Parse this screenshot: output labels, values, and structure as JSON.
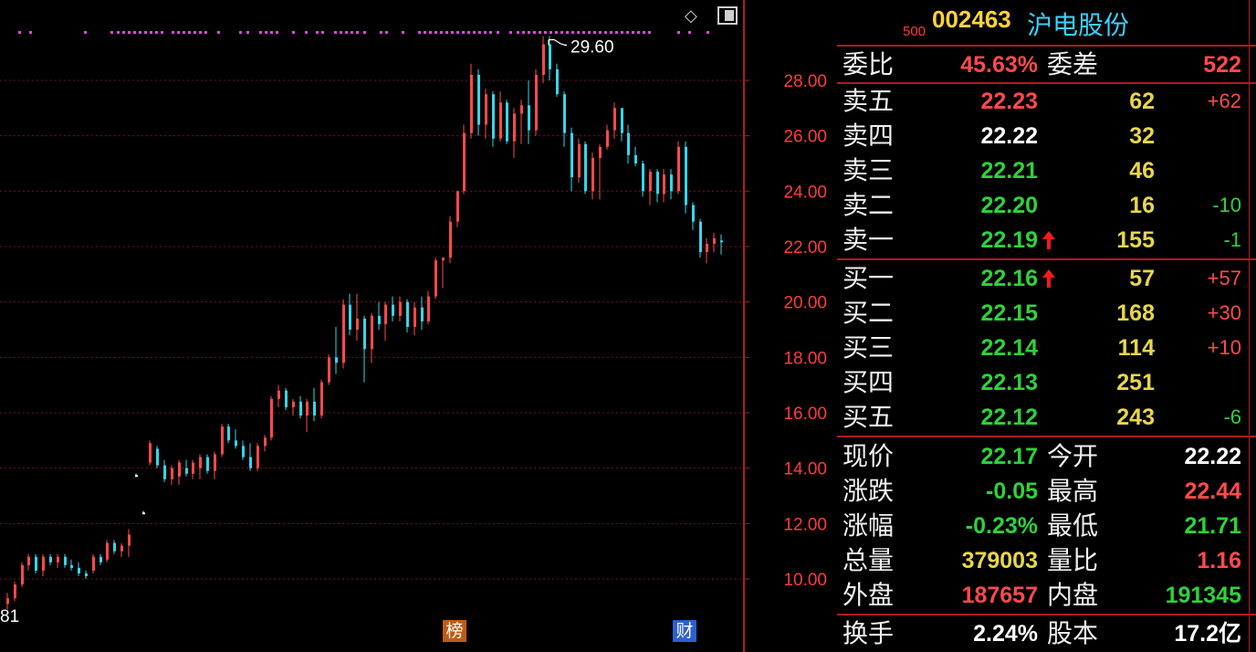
{
  "chart_data": {
    "type": "candlestick",
    "y_ticks": [
      "28.00",
      "26.00",
      "24.00",
      "22.00",
      "20.00",
      "18.00",
      "16.00",
      "14.00",
      "12.00",
      "10.00"
    ],
    "y_tick_values": [
      28,
      26,
      24,
      22,
      20,
      18,
      16,
      14,
      12,
      10
    ],
    "max_label": "29.60",
    "min_label_partial": "81",
    "candles": [
      [
        9.1,
        9.5,
        8.9,
        9.3
      ],
      [
        9.3,
        9.9,
        9.2,
        9.8
      ],
      [
        9.8,
        10.6,
        9.7,
        10.5
      ],
      [
        10.5,
        10.9,
        10.3,
        10.8
      ],
      [
        10.8,
        10.9,
        10.2,
        10.3
      ],
      [
        10.3,
        10.9,
        10.1,
        10.8
      ],
      [
        10.8,
        10.9,
        10.5,
        10.6
      ],
      [
        10.6,
        10.9,
        10.4,
        10.8
      ],
      [
        10.8,
        10.9,
        10.4,
        10.5
      ],
      [
        10.5,
        10.7,
        10.3,
        10.4
      ],
      [
        10.4,
        10.6,
        10.1,
        10.2
      ],
      [
        10.2,
        10.3,
        10.0,
        10.1
      ],
      [
        10.3,
        10.9,
        10.2,
        10.8
      ],
      [
        10.8,
        10.9,
        10.5,
        10.6
      ],
      [
        10.7,
        11.4,
        10.6,
        11.3
      ],
      [
        11.3,
        11.4,
        10.9,
        11.0
      ],
      [
        11.0,
        11.3,
        10.8,
        11.2
      ],
      [
        11.2,
        11.8,
        10.8,
        11.6
      ],
      [
        13.7,
        13.8,
        13.7,
        13.75
      ],
      [
        12.4,
        12.45,
        12.35,
        12.4
      ],
      [
        14.2,
        15.0,
        14.1,
        14.9
      ],
      [
        14.7,
        14.8,
        14.0,
        14.1
      ],
      [
        14.1,
        14.3,
        13.5,
        13.6
      ],
      [
        13.6,
        14.1,
        13.4,
        14.0
      ],
      [
        13.7,
        14.3,
        13.4,
        14.2
      ],
      [
        14.0,
        14.3,
        13.7,
        13.8
      ],
      [
        13.8,
        14.3,
        13.6,
        14.2
      ],
      [
        14.0,
        14.5,
        13.6,
        14.4
      ],
      [
        14.4,
        14.5,
        13.8,
        13.9
      ],
      [
        13.9,
        14.6,
        13.6,
        14.5
      ],
      [
        14.5,
        15.6,
        14.4,
        15.5
      ],
      [
        15.5,
        15.6,
        14.9,
        15.0
      ],
      [
        15.0,
        15.4,
        14.7,
        14.8
      ],
      [
        14.8,
        15.0,
        14.3,
        14.4
      ],
      [
        14.4,
        14.9,
        13.9,
        14.0
      ],
      [
        14.0,
        14.9,
        13.9,
        14.8
      ],
      [
        14.8,
        15.2,
        14.6,
        15.1
      ],
      [
        15.1,
        16.6,
        15.0,
        16.5
      ],
      [
        16.5,
        17.0,
        16.2,
        16.8
      ],
      [
        16.8,
        16.9,
        16.1,
        16.2
      ],
      [
        16.2,
        16.5,
        15.9,
        16.4
      ],
      [
        16.4,
        16.6,
        15.8,
        15.9
      ],
      [
        15.9,
        16.5,
        15.3,
        16.4
      ],
      [
        16.4,
        16.9,
        15.7,
        15.9
      ],
      [
        15.9,
        17.2,
        15.8,
        17.1
      ],
      [
        17.1,
        18.1,
        17.0,
        18.0
      ],
      [
        18.0,
        19.1,
        17.4,
        17.8
      ],
      [
        17.8,
        20.1,
        17.6,
        19.9
      ],
      [
        19.9,
        20.3,
        18.8,
        19.0
      ],
      [
        19.0,
        20.3,
        18.6,
        19.4
      ],
      [
        19.4,
        19.5,
        17.1,
        18.3
      ],
      [
        18.3,
        19.6,
        17.8,
        19.5
      ],
      [
        19.5,
        20.0,
        19.0,
        19.2
      ],
      [
        19.2,
        20.0,
        18.6,
        19.9
      ],
      [
        19.9,
        20.2,
        19.3,
        19.5
      ],
      [
        19.5,
        20.2,
        19.3,
        20.0
      ],
      [
        20.0,
        20.1,
        18.9,
        19.1
      ],
      [
        19.1,
        20.0,
        18.8,
        19.8
      ],
      [
        19.8,
        20.2,
        19.0,
        19.3
      ],
      [
        19.3,
        20.4,
        19.2,
        20.2
      ],
      [
        20.2,
        21.6,
        20.1,
        21.5
      ],
      [
        21.5,
        21.6,
        20.5,
        21.6
      ],
      [
        21.6,
        23.1,
        21.4,
        22.9
      ],
      [
        22.9,
        24.0,
        22.7,
        24.0
      ],
      [
        24.0,
        26.4,
        23.9,
        26.1
      ],
      [
        26.1,
        28.6,
        25.9,
        28.2
      ],
      [
        28.2,
        28.4,
        26.0,
        26.4
      ],
      [
        26.4,
        27.7,
        25.9,
        27.5
      ],
      [
        27.5,
        27.6,
        25.6,
        25.9
      ],
      [
        25.9,
        27.6,
        25.8,
        27.2
      ],
      [
        27.2,
        27.3,
        25.7,
        25.8
      ],
      [
        25.8,
        27.0,
        25.2,
        26.8
      ],
      [
        26.8,
        27.3,
        25.7,
        27.1
      ],
      [
        27.1,
        28.0,
        25.7,
        26.2
      ],
      [
        26.2,
        28.4,
        26.0,
        28.2
      ],
      [
        28.2,
        29.6,
        27.9,
        29.3
      ],
      [
        29.3,
        29.6,
        28.0,
        28.4
      ],
      [
        28.4,
        28.6,
        27.4,
        27.5
      ],
      [
        27.5,
        27.6,
        25.6,
        26.1
      ],
      [
        26.1,
        26.3,
        24.0,
        24.5
      ],
      [
        24.5,
        25.9,
        24.3,
        25.7
      ],
      [
        25.7,
        25.8,
        23.9,
        24.0
      ],
      [
        24.0,
        25.4,
        23.7,
        25.2
      ],
      [
        25.2,
        25.7,
        23.7,
        25.6
      ],
      [
        25.6,
        26.4,
        25.5,
        26.2
      ],
      [
        26.2,
        27.2,
        25.9,
        27.0
      ],
      [
        27.0,
        27.0,
        25.8,
        26.1
      ],
      [
        26.1,
        26.4,
        25.0,
        25.3
      ],
      [
        25.3,
        25.6,
        24.9,
        25.0
      ],
      [
        25.0,
        25.1,
        23.8,
        24.0
      ],
      [
        24.0,
        24.8,
        23.5,
        24.7
      ],
      [
        24.7,
        24.8,
        23.6,
        23.9
      ],
      [
        23.9,
        24.8,
        23.6,
        24.6
      ],
      [
        24.6,
        24.8,
        23.7,
        24.0
      ],
      [
        24.0,
        25.8,
        23.9,
        25.6
      ],
      [
        25.6,
        25.8,
        23.2,
        23.5
      ],
      [
        23.5,
        23.6,
        22.6,
        22.9
      ],
      [
        22.9,
        23.0,
        21.6,
        21.8
      ],
      [
        21.8,
        22.3,
        21.4,
        22.1
      ],
      [
        22.1,
        22.5,
        21.8,
        22.3
      ],
      [
        22.22,
        22.44,
        21.71,
        22.17
      ]
    ],
    "dots_top": true,
    "markers": [
      {
        "label": "榜"
      },
      {
        "label": "财"
      }
    ]
  },
  "colors": {
    "up": "#ff4a4a",
    "down": "#35d6ea",
    "grid": "#7a1414",
    "axis": "#b01c1c",
    "axis_text": "#ff3b3b",
    "dots": "#e045e0"
  },
  "icons": {
    "diamond": "diamond-icon",
    "window": "window-icon"
  },
  "quote": {
    "index_tag": "500",
    "code": "002463",
    "name": "沪电股份",
    "webi_label": "委比",
    "webi_value": "45.63%",
    "weicha_label": "委差",
    "weicha_value": "522",
    "asks": [
      {
        "label": "卖五",
        "price": "22.23",
        "vol": "62",
        "chg": "+62"
      },
      {
        "label": "卖四",
        "price": "22.22",
        "vol": "32",
        "chg": ""
      },
      {
        "label": "卖三",
        "price": "22.21",
        "vol": "46",
        "chg": ""
      },
      {
        "label": "卖二",
        "price": "22.20",
        "vol": "16",
        "chg": "-10"
      },
      {
        "label": "卖一",
        "price": "22.19",
        "vol": "155",
        "chg": "-1"
      }
    ],
    "bids": [
      {
        "label": "买一",
        "price": "22.16",
        "vol": "57",
        "chg": "+57"
      },
      {
        "label": "买二",
        "price": "22.15",
        "vol": "168",
        "chg": "+30"
      },
      {
        "label": "买三",
        "price": "22.14",
        "vol": "114",
        "chg": "+10"
      },
      {
        "label": "买四",
        "price": "22.13",
        "vol": "251",
        "chg": ""
      },
      {
        "label": "买五",
        "price": "22.12",
        "vol": "243",
        "chg": "-6"
      }
    ],
    "stats": [
      {
        "l1": "现价",
        "v1": "22.17",
        "l2": "今开",
        "v2": "22.22"
      },
      {
        "l1": "涨跌",
        "v1": "-0.05",
        "l2": "最高",
        "v2": "22.44"
      },
      {
        "l1": "涨幅",
        "v1": "-0.23%",
        "l2": "最低",
        "v2": "21.71"
      },
      {
        "l1": "总量",
        "v1": "379003",
        "l2": "量比",
        "v2": "1.16"
      },
      {
        "l1": "外盘",
        "v1": "187657",
        "l2": "内盘",
        "v2": "191345"
      },
      {
        "l1": "换手",
        "v1": "2.24%",
        "l2": "股本",
        "v2": "17.2亿"
      }
    ]
  }
}
